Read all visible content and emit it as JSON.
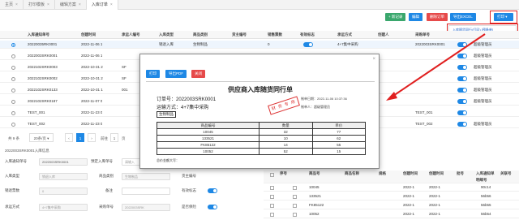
{
  "tabs": [
    {
      "label": "主页",
      "active": false
    },
    {
      "label": "打印模板",
      "active": false
    },
    {
      "label": "编辑方案",
      "active": false
    },
    {
      "label": "入库订单",
      "active": true
    }
  ],
  "toolbar": {
    "add": "+ 新记录",
    "edit": "编辑",
    "delete": "删除订单",
    "export": "导出EXCEL",
    "print": "打印",
    "print_menu": "入库随货同行(打印)  [预备单]"
  },
  "columns": [
    "入库通知单号",
    "创建时间",
    "承运人编号",
    "入库类型",
    "商品类别",
    "货主编号",
    "销售票数",
    "有效标志",
    "承运方式",
    "创建人",
    "采购单号"
  ],
  "rows": [
    {
      "selected": true,
      "no": "20220035RK0001",
      "time": "2022-11-06 1",
      "carrier": "",
      "type": "销退入库",
      "category": "生物制品",
      "owner": "",
      "count": "0",
      "active": true,
      "way": "4+7集中采购",
      "creator": "",
      "po": "2022003SRK0001",
      "buyer": "超级管理员"
    },
    {
      "selected": false,
      "no": "2022003SRK0001",
      "time": "2022-11-06 1",
      "carrier": "",
      "type": "",
      "category": "",
      "owner": "",
      "count": "",
      "active": true,
      "way": "",
      "creator": "",
      "po": "",
      "buyer": "超级管理员"
    },
    {
      "selected": false,
      "no": "2022102SRK0003",
      "time": "2022-10-31 2",
      "carrier": "SF",
      "type": "",
      "category": "",
      "owner": "",
      "count": "",
      "active": true,
      "way": "",
      "creator": "",
      "po": "",
      "buyer": "超级管理员"
    },
    {
      "selected": false,
      "no": "2022102SRK0002",
      "time": "2022-10-31 2",
      "carrier": "SF",
      "type": "",
      "category": "",
      "owner": "",
      "count": "",
      "active": true,
      "way": "",
      "creator": "",
      "po": "",
      "buyer": "超级管理员"
    },
    {
      "selected": false,
      "no": "2022102SRK0133",
      "time": "2022-10-31 1",
      "carrier": "001",
      "type": "",
      "category": "",
      "owner": "",
      "count": "",
      "active": true,
      "way": "",
      "creator": "",
      "po": "",
      "buyer": "超级管理员"
    },
    {
      "selected": false,
      "no": "2022102SRK0187",
      "time": "2022-11-07 0",
      "carrier": "",
      "type": "",
      "category": "",
      "owner": "",
      "count": "",
      "active": true,
      "way": "",
      "creator": "",
      "po": "",
      "buyer": "超级管理员"
    },
    {
      "selected": false,
      "no": "TEST_001",
      "time": "2022-11-23 0",
      "carrier": "",
      "type": "",
      "category": "",
      "owner": "",
      "count": "",
      "active": false,
      "way": "",
      "creator": "",
      "po": "TEST_001",
      "buyer": ""
    },
    {
      "selected": false,
      "no": "TEST_002",
      "time": "2022-11-23 0",
      "carrier": "",
      "type": "",
      "category": "",
      "owner": "",
      "count": "",
      "active": true,
      "way": "",
      "creator": "",
      "po": "TEST_002",
      "buyer": "超级管理员"
    }
  ],
  "pager": {
    "total": "共 9 条",
    "page_size": "20条/页",
    "current": "1",
    "goto_label": "前往",
    "goto_value": "1",
    "page_unit": "页"
  },
  "form": {
    "section_title": "2022003SRK0001入库信息",
    "notice_no_label": "入库通知单号",
    "notice_no_value": "2022003SRK0001",
    "pre_no_label": "预定入库单号",
    "pre_no_placeholder": "请输入",
    "carrier_label": "承运人编号",
    "type_label": "入库类型",
    "type_value": "销退入库",
    "category_label": "商品类别",
    "category_value": "生物制品",
    "owner_label": "货主编号",
    "count_label": "销退票数",
    "count_value": "0",
    "remark_label": "备注",
    "active_label": "有效标志",
    "way_label": "承运方式",
    "way_value": "4+7集中采购",
    "po_label": "采购单号",
    "po_value": "2022003SRK",
    "qc_label": "是否保险"
  },
  "detail": {
    "columns": [
      "序号",
      "商品号",
      "商品名称",
      "规格",
      "创建时间",
      "创建时间",
      "批号",
      "入库通知单明细号",
      "关联号"
    ],
    "rows": [
      {
        "no": "10045",
        "date1": "2022-1",
        "date2": "2022-1",
        "id": "90c14"
      },
      {
        "no": "133521",
        "date1": "2022-1",
        "date2": "2022-1",
        "id": "56b56"
      },
      {
        "no": "FK85122",
        "date1": "2022-1",
        "date2": "2022-1",
        "id": "56b55"
      },
      {
        "no": "10052",
        "date1": "2022-1",
        "date2": "2022-1",
        "id": "56b54"
      }
    ]
  },
  "modal": {
    "print_btn": "打印",
    "pdf_btn": "导出PDF",
    "close_btn": "关闭",
    "title": "供应商入库随货同行单",
    "order_label": "订单号：",
    "order_no": "2022003SRK0001",
    "way_label": "运输方式：",
    "way_value": "4+7集中采购",
    "category": "生物制品",
    "date_label": "制单日期：2022-11-06 10:37:36",
    "maker_label": "制单人：超级管理员",
    "stamp": "财 务 专 用",
    "table_headers": [
      "商品编号",
      "数量",
      "单价"
    ],
    "table_rows": [
      [
        "10045",
        "32",
        "77"
      ],
      [
        "133521",
        "10",
        "62"
      ],
      [
        "FK85122",
        "14",
        "55"
      ],
      [
        "10052",
        "52",
        "15"
      ]
    ],
    "footer": "总价金额大写："
  },
  "colors": {
    "primary": "#1e88e5",
    "green": "#3aa76d",
    "red": "#e64a4a",
    "highlight": "#e02020"
  }
}
